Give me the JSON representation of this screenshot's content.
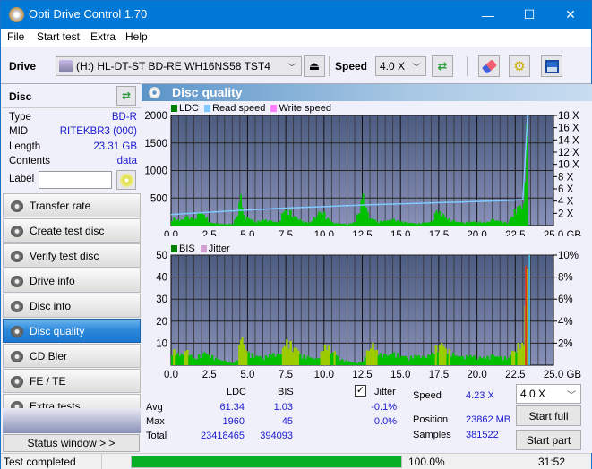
{
  "window": {
    "title": "Opti Drive Control 1.70",
    "controls": {
      "minimize": "—",
      "maximize": "☐",
      "close": "✕"
    }
  },
  "menu": [
    "File",
    "Start test",
    "Extra",
    "Help"
  ],
  "toolbar": {
    "drive_label": "Drive",
    "drive_value": "(H:)  HL-DT-ST BD-RE  WH16NS58 TST4",
    "speed_label": "Speed",
    "speed_value": "4.0 X",
    "icons": [
      "eject-icon",
      "refresh-icon",
      "eraser-icon",
      "settings-icon",
      "save-icon"
    ]
  },
  "disc": {
    "header": "Disc",
    "rows": [
      {
        "key": "Type",
        "value": "BD-R"
      },
      {
        "key": "MID",
        "value": "RITEKBR3 (000)"
      },
      {
        "key": "Length",
        "value": "23.31 GB"
      },
      {
        "key": "Contents",
        "value": "data"
      }
    ],
    "label_key": "Label",
    "label_value": ""
  },
  "nav": [
    {
      "label": "Transfer rate",
      "active": false
    },
    {
      "label": "Create test disc",
      "active": false
    },
    {
      "label": "Verify test disc",
      "active": false
    },
    {
      "label": "Drive info",
      "active": false
    },
    {
      "label": "Disc info",
      "active": false
    },
    {
      "label": "Disc quality",
      "active": true
    },
    {
      "label": "CD Bler",
      "active": false
    },
    {
      "label": "FE / TE",
      "active": false
    },
    {
      "label": "Extra tests",
      "active": false
    }
  ],
  "status_window_button": "Status window > >",
  "panel": {
    "title": "Disc quality"
  },
  "colors": {
    "ldc": "#00c000",
    "bis": "#66cc00",
    "read_speed": "#80c8ff",
    "write_speed": "#ff80ff",
    "jitter": "#d0a0d0",
    "plot_bg_top": "#4c5c80",
    "plot_bg_bottom": "#8890b8",
    "progress": "#06b025"
  },
  "chart_data": [
    {
      "type": "bar",
      "title": "LDC",
      "legend": [
        "LDC",
        "Read speed",
        "Write speed"
      ],
      "legend_position": "top-left",
      "xlabel": "GB",
      "xlim": [
        0,
        25
      ],
      "ylim": [
        0,
        2000
      ],
      "x_ticks": [
        "0.0",
        "2.5",
        "5.0",
        "7.5",
        "10.0",
        "12.5",
        "15.0",
        "17.5",
        "20.0",
        "22.5",
        "25.0 GB"
      ],
      "y_ticks": [
        "500",
        "1000",
        "1500",
        "2000"
      ],
      "y2_ticks": [
        "2 X",
        "4 X",
        "6 X",
        "8 X",
        "10 X",
        "12 X",
        "14 X",
        "16 X",
        "18 X"
      ],
      "y2lim": [
        0,
        18
      ],
      "grid": true,
      "series": [
        {
          "name": "LDC",
          "x": [
            0,
            0.5,
            1,
            1.5,
            1.8,
            2.2,
            2.5,
            3,
            3.5,
            4,
            4.3,
            4.5,
            4.7,
            5,
            5.5,
            6,
            6.5,
            7,
            7.3,
            7.6,
            8,
            8.5,
            9,
            9.5,
            9.8,
            10.2,
            10.5,
            11,
            11.5,
            12,
            12.5,
            12.8,
            13,
            13.5,
            14,
            14.5,
            15,
            15.5,
            16,
            16.5,
            17,
            17.3,
            17.6,
            18,
            18.5,
            19,
            19.5,
            20,
            20.5,
            21,
            21.5,
            22,
            22.3,
            22.6,
            23,
            23.2,
            23.31
          ],
          "values": [
            150,
            100,
            180,
            120,
            300,
            200,
            60,
            40,
            30,
            40,
            250,
            600,
            200,
            150,
            80,
            120,
            90,
            60,
            300,
            320,
            200,
            80,
            60,
            250,
            300,
            150,
            60,
            40,
            30,
            80,
            600,
            250,
            150,
            80,
            100,
            120,
            80,
            60,
            40,
            60,
            80,
            300,
            250,
            150,
            80,
            60,
            80,
            80,
            60,
            120,
            80,
            60,
            250,
            400,
            400,
            1960,
            1960
          ]
        },
        {
          "name": "Read speed",
          "x": [
            0,
            1,
            2,
            3,
            4,
            5,
            6,
            7,
            8,
            9,
            10,
            11,
            12,
            13,
            14,
            15,
            16,
            17,
            18,
            19,
            20,
            21,
            22,
            23,
            23.31
          ],
          "values": [
            1.8,
            1.95,
            2.1,
            2.25,
            2.4,
            2.55,
            2.65,
            2.8,
            2.9,
            3.0,
            3.1,
            3.2,
            3.3,
            3.4,
            3.48,
            3.55,
            3.62,
            3.7,
            3.78,
            3.85,
            3.93,
            4.0,
            4.1,
            4.23,
            18
          ]
        },
        {
          "name": "Write speed",
          "x": [],
          "values": []
        }
      ]
    },
    {
      "type": "bar",
      "title": "BIS",
      "legend": [
        "BIS",
        "Jitter"
      ],
      "legend_position": "top-left",
      "xlabel": "GB",
      "xlim": [
        0,
        25
      ],
      "ylim": [
        0,
        50
      ],
      "x_ticks": [
        "0.0",
        "2.5",
        "5.0",
        "7.5",
        "10.0",
        "12.5",
        "15.0",
        "17.5",
        "20.0",
        "22.5",
        "25.0 GB"
      ],
      "y_ticks": [
        "10",
        "20",
        "30",
        "40",
        "50"
      ],
      "y2_ticks": [
        "2%",
        "4%",
        "6%",
        "8%",
        "10%"
      ],
      "y2lim": [
        0,
        10
      ],
      "grid": true,
      "series": [
        {
          "name": "BIS",
          "x": [
            0,
            0.5,
            1,
            1.5,
            2,
            2.5,
            3,
            3.5,
            4,
            4.3,
            4.5,
            4.7,
            5,
            5.5,
            6,
            6.5,
            7,
            7.5,
            8,
            8.5,
            9,
            9.5,
            10,
            10.5,
            11,
            11.5,
            12,
            12.5,
            13,
            13.5,
            14,
            14.5,
            15,
            15.5,
            16,
            16.5,
            17,
            17.5,
            18,
            18.5,
            19,
            19.5,
            20,
            20.5,
            21,
            21.5,
            22,
            22.5,
            23,
            23.2,
            23.31
          ],
          "values": [
            8,
            5,
            7,
            3,
            7,
            5,
            3,
            2,
            1,
            3,
            16,
            10,
            6,
            5,
            4,
            6,
            5,
            12,
            10,
            5,
            4,
            3,
            10,
            8,
            3,
            2,
            1,
            2,
            12,
            6,
            5,
            6,
            5,
            4,
            5,
            4,
            6,
            12,
            8,
            5,
            4,
            5,
            4,
            4,
            5,
            4,
            4,
            10,
            11,
            45,
            45
          ]
        },
        {
          "name": "Jitter",
          "x": [
            23.2
          ],
          "values": [
            9
          ]
        }
      ]
    }
  ],
  "stats": {
    "col_ldc": "LDC",
    "col_bis": "BIS",
    "rows": [
      {
        "label": "Avg",
        "ldc": "61.34",
        "bis": "1.03",
        "jitter": "-0.1%"
      },
      {
        "label": "Max",
        "ldc": "1960",
        "bis": "45",
        "jitter": "0.0%"
      },
      {
        "label": "Total",
        "ldc": "23418465",
        "bis": "394093",
        "jitter": ""
      }
    ],
    "jitter_label": "Jitter",
    "jitter_checked": true,
    "speed_label": "Speed",
    "speed_value": "4.23 X",
    "position_label": "Position",
    "position_value": "23862 MB",
    "samples_label": "Samples",
    "samples_value": "381522",
    "speed_select": "4.0 X",
    "start_full": "Start full",
    "start_part": "Start part"
  },
  "status": {
    "text": "Test completed",
    "progress_percent": 100,
    "progress_label": "100.0%",
    "time": "31:52"
  }
}
